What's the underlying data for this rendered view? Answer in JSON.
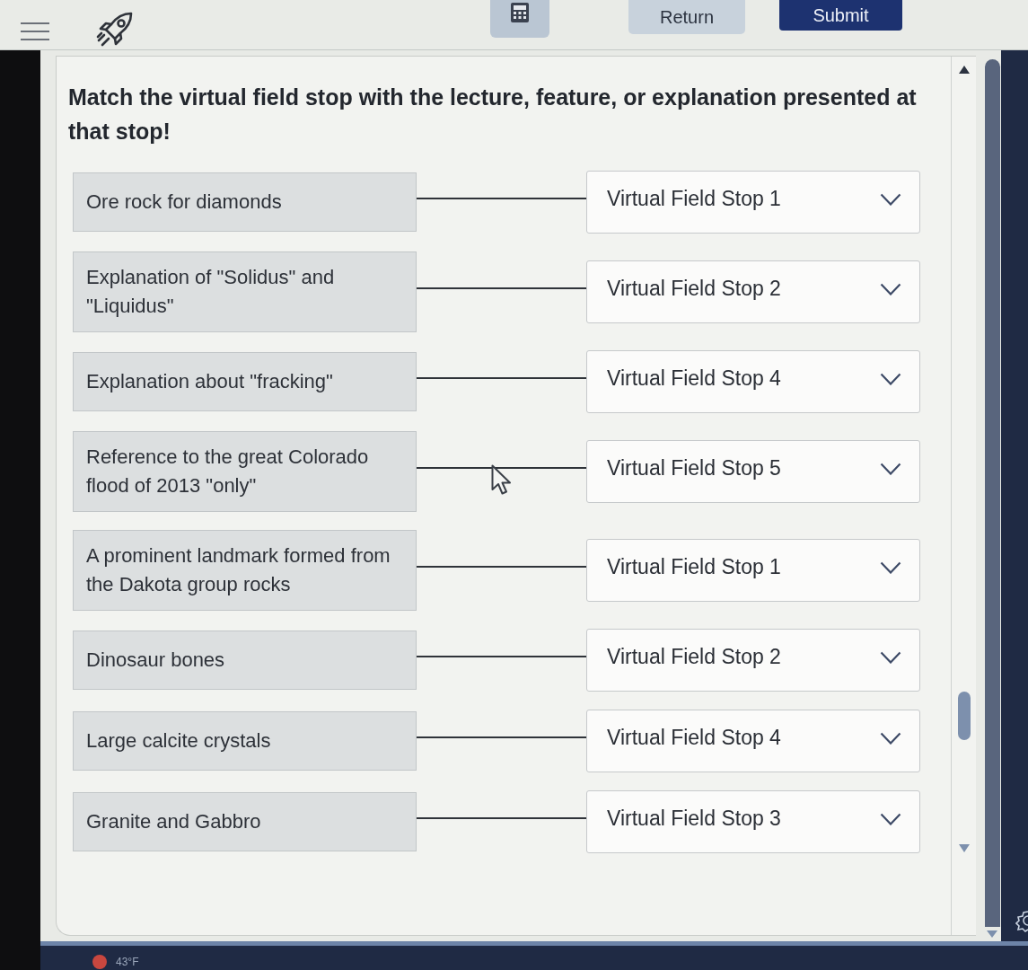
{
  "toolbar": {
    "buttons": [
      {
        "label": "Return",
        "kind": "secondary"
      },
      {
        "label": "Submit",
        "kind": "primary"
      }
    ]
  },
  "question": {
    "prompt": "Match the virtual field stop with the lecture, feature, or explanation presented at that stop!",
    "pairs": [
      {
        "item": "Ore rock for diamonds",
        "answer": "Virtual Field Stop 1"
      },
      {
        "item": "Explanation of \"Solidus\" and \"Liquidus\"",
        "answer": "Virtual Field Stop 2"
      },
      {
        "item": "Explanation about \"fracking\"",
        "answer": "Virtual Field Stop 4"
      },
      {
        "item": "Reference to the great Colorado flood of 2013 \"only\"",
        "answer": "Virtual Field Stop 5"
      },
      {
        "item": "A prominent landmark formed from the Dakota group rocks",
        "answer": "Virtual Field Stop 1"
      },
      {
        "item": "Dinosaur bones",
        "answer": "Virtual Field Stop 2"
      },
      {
        "item": "Large calcite crystals",
        "answer": "Virtual Field Stop 4"
      },
      {
        "item": "Granite and Gabbro",
        "answer": "Virtual Field Stop 3"
      }
    ]
  },
  "taskbar": {
    "weather": "43°F"
  }
}
